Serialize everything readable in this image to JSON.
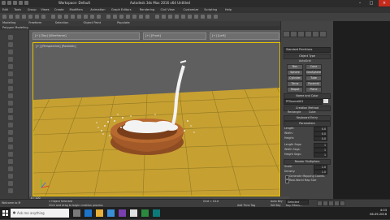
{
  "window": {
    "title": "Autodesk 3ds Max 2016 x64   Untitled",
    "workspace_label": "Workspace: Default"
  },
  "menu": [
    "Edit",
    "Tools",
    "Group",
    "Views",
    "Create",
    "Modifiers",
    "Animation",
    "Graph Editors",
    "Rendering",
    "Civil View",
    "Customize",
    "Scripting",
    "Help"
  ],
  "ribbon": {
    "tabs": [
      "Modeling",
      "Freeform",
      "Selection",
      "Object Paint",
      "Populate"
    ],
    "sub_label": "Polygon Modeling"
  },
  "viewports": {
    "mini_labels": [
      "[+] [Top] [Wireframe]",
      "[+] [Front]",
      "[+] [Left]"
    ],
    "main_label": "[+] [Perspective] [Realistic]",
    "colors": {
      "floor": "#c9a12f",
      "grid": "#8a7420",
      "bowl": "#a0582a",
      "particles": "#f2f2f2"
    }
  },
  "command_panel": {
    "object_name": "Standard Primitives",
    "object_type_header": "Object Type",
    "autogrid": "AutoGrid",
    "buttons": [
      "Box",
      "Cone",
      "Sphere",
      "GeoSphere",
      "Cylinder",
      "Tube",
      "Torus",
      "Pyramid",
      "Teapot",
      "Plane"
    ],
    "name_color_header": "Name and Color",
    "name_value": "PFSource001",
    "creation_header": "Creation Method",
    "creation_options": [
      "Rectangle",
      "Cube"
    ],
    "keyboard_entry": "Keyboard Entry",
    "parameters_header": "Parameters",
    "params": [
      {
        "label": "Length:",
        "value": "0.0"
      },
      {
        "label": "Width:",
        "value": "0.0"
      },
      {
        "label": "Height:",
        "value": "0.0"
      },
      {
        "label": "Length Segs:",
        "value": "1"
      },
      {
        "label": "Width Segs:",
        "value": "1"
      },
      {
        "label": "Height Segs:",
        "value": "1"
      }
    ],
    "render_mult_header": "Render Multipliers",
    "render_params": [
      {
        "label": "Scale:",
        "value": "1.0"
      },
      {
        "label": "Density:",
        "value": "1.0"
      }
    ],
    "checkbox_1": "Generate Mapping Coords.",
    "checkbox_2": "Real-World Map Size"
  },
  "timeline": {
    "frame_label": "0 / 100"
  },
  "status": {
    "selected": "1 Object Selected",
    "prompt": "Click and drag to begin creation process",
    "welcome": "Welcome to M",
    "grid": "Grid = 10.0",
    "add_time_tag": "Add Time Tag",
    "autokey": "Auto Key",
    "selected_dropdown": "Selected",
    "set_key": "Set Key",
    "key_filters": "Key Filters..."
  },
  "taskbar": {
    "search_placeholder": "Ask me anything",
    "time": "4:03",
    "date": "06-09-2016"
  }
}
